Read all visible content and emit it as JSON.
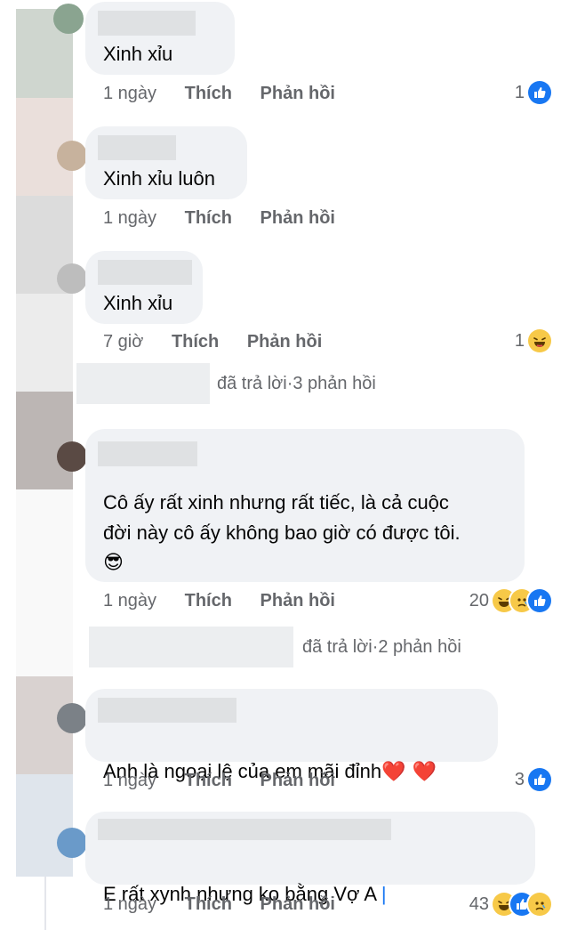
{
  "comments": [
    {
      "text": "Xinh xỉu",
      "time": "1 ngày",
      "like_label": "Thích",
      "reply_label": "Phản hồi",
      "reaction_count": "1",
      "reactions": [
        "like"
      ]
    },
    {
      "text": "Xinh xỉu luôn",
      "time": "1 ngày",
      "like_label": "Thích",
      "reply_label": "Phản hồi",
      "reaction_count": "",
      "reactions": []
    },
    {
      "text": "Xinh xỉu",
      "time": "7 giờ",
      "like_label": "Thích",
      "reply_label": "Phản hồi",
      "reaction_count": "1",
      "reactions": [
        "haha"
      ],
      "replies_summary": {
        "text": "đã trả lời",
        "count": "3 phản hồi"
      }
    },
    {
      "text": "Cô ấy rất xinh nhưng rất tiếc, là cả cuộc\nđời này cô ấy không bao giờ có được tôi.",
      "emoji": "😎",
      "time": "1 ngày",
      "like_label": "Thích",
      "reply_label": "Phản hồi",
      "reaction_count": "20",
      "reactions": [
        "haha",
        "sad",
        "like"
      ],
      "replies_summary": {
        "text": "đã trả lời",
        "count": "2 phản hồi"
      }
    },
    {
      "text": "Anh là ngoại lệ của em mãi đỉnh",
      "emoji": "❤️ ❤️",
      "time": "1 ngày",
      "like_label": "Thích",
      "reply_label": "Phản hồi",
      "reaction_count": "3",
      "reactions": [
        "like"
      ]
    },
    {
      "text": "E rất xynh nhưng ko bằng Vợ A",
      "time": "1 ngày",
      "like_label": "Thích",
      "reply_label": "Phản hồi",
      "reaction_count": "43",
      "reactions": [
        "haha",
        "like",
        "sad"
      ]
    }
  ],
  "separator": " · ",
  "colors": {
    "bubble": "#f0f2f5",
    "meta": "#65676b",
    "like_blue": "#1877f2",
    "emoji_yellow": "#f7c948"
  },
  "icons": {
    "like": "thumbs-up-icon",
    "haha": "laughing-face-icon",
    "sad": "sad-face-icon",
    "cool": "sunglasses-face-icon",
    "heart": "red-heart-icon"
  }
}
